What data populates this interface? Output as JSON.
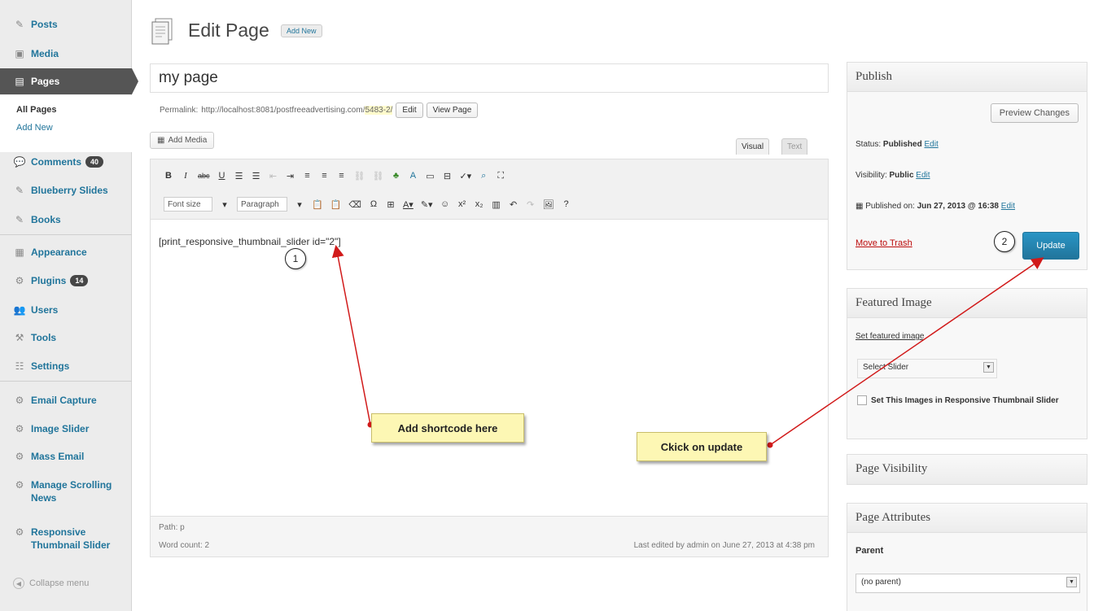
{
  "sidebar": {
    "items": [
      {
        "label": "Posts",
        "icon": "pin-icon"
      },
      {
        "label": "Media",
        "icon": "media-icon"
      },
      {
        "label": "Pages",
        "icon": "pages-icon"
      },
      {
        "label": "Comments",
        "icon": "comment-icon",
        "badge": "40"
      },
      {
        "label": "Blueberry Slides",
        "icon": "pin-icon"
      },
      {
        "label": "Books",
        "icon": "pin-icon"
      },
      {
        "label": "Appearance",
        "icon": "appearance-icon"
      },
      {
        "label": "Plugins",
        "icon": "plugins-icon",
        "badge": "14"
      },
      {
        "label": "Users",
        "icon": "users-icon"
      },
      {
        "label": "Tools",
        "icon": "tools-icon"
      },
      {
        "label": "Settings",
        "icon": "settings-icon"
      },
      {
        "label": "Email Capture",
        "icon": "gear-icon"
      },
      {
        "label": "Image Slider",
        "icon": "gear-icon"
      },
      {
        "label": "Mass Email",
        "icon": "gear-icon"
      },
      {
        "label": "Manage Scrolling News",
        "icon": "gear-icon"
      },
      {
        "label": "Responsive Thumbnail Slider",
        "icon": "gear-icon"
      }
    ],
    "submenu": {
      "all_pages": "All Pages",
      "add_new": "Add New"
    },
    "collapse": "Collapse menu"
  },
  "header": {
    "title": "Edit Page",
    "add_new": "Add New"
  },
  "editor": {
    "title_value": "my page",
    "permalink_label": "Permalink:",
    "permalink_url": "http://localhost:8081/postfreeadvertising.com/",
    "permalink_slug": "5483-2/",
    "edit_btn": "Edit",
    "view_btn": "View Page",
    "add_media": "Add Media",
    "tab_visual": "Visual",
    "tab_text": "Text",
    "font_size": "Font size",
    "paragraph": "Paragraph",
    "content": "[print_responsive_thumbnail_slider id=\"2\"]",
    "path": "Path: p",
    "word_count": "Word count: 2",
    "last_edited": "Last edited by admin on June 27, 2013 at 4:38 pm"
  },
  "annotations": {
    "step1": "1",
    "step2": "2",
    "callout1": "Add shortcode here",
    "callout2": "Ckick on update",
    "arrow_color": "#d11a1a"
  },
  "publish": {
    "title": "Publish",
    "preview": "Preview Changes",
    "status_label": "Status:",
    "status_value": "Published",
    "visibility_label": "Visibility:",
    "visibility_value": "Public",
    "published_on_label": "Published on:",
    "published_on_value": "Jun 27, 2013 @ 16:38",
    "edit": "Edit",
    "trash": "Move to Trash",
    "update": "Update"
  },
  "featured": {
    "title": "Featured Image",
    "set_link": "Set featured image",
    "select_value": "Select Slider",
    "checkbox_label": "Set This Images in Responsive Thumbnail Slider"
  },
  "visibility_box": {
    "title": "Page Visibility"
  },
  "attributes": {
    "title": "Page Attributes",
    "parent_label": "Parent",
    "parent_value": "(no parent)"
  }
}
